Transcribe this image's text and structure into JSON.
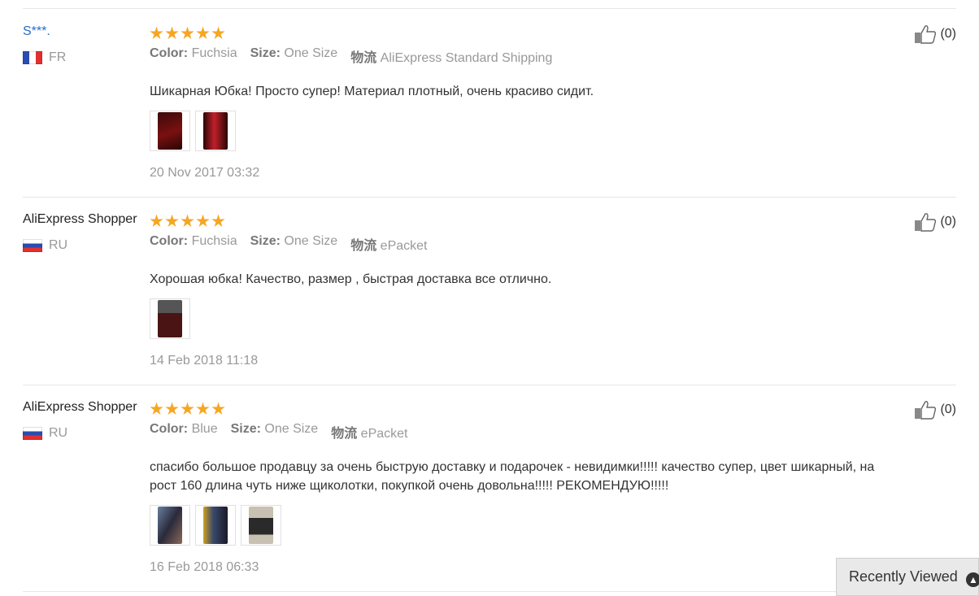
{
  "reviews": [
    {
      "user": "S***.",
      "country": "FR",
      "rating": 5,
      "color_label": "Color:",
      "color_value": "Fuchsia",
      "size_label": "Size:",
      "size_value": "One Size",
      "ship_label": "物流",
      "ship_value": "AliExpress Standard Shipping",
      "text": "Шикарная Юбка! Просто супер! Материал плотный, очень красиво сидит.",
      "date": "20 Nov 2017 03:32",
      "likes": "(0)",
      "photos": 2
    },
    {
      "user": "AliExpress Shopper",
      "country": "RU",
      "rating": 5,
      "color_label": "Color:",
      "color_value": "Fuchsia",
      "size_label": "Size:",
      "size_value": "One Size",
      "ship_label": "物流",
      "ship_value": "ePacket",
      "text": "Хорошая юбка! Качество, размер , быстрая доставка все отлично.",
      "date": "14 Feb 2018 11:18",
      "likes": "(0)",
      "photos": 1
    },
    {
      "user": "AliExpress Shopper",
      "country": "RU",
      "rating": 5,
      "color_label": "Color:",
      "color_value": "Blue",
      "size_label": "Size:",
      "size_value": "One Size",
      "ship_label": "物流",
      "ship_value": "ePacket",
      "text": "спасибо большое продавцу за очень быструю доставку и подарочек - невидимки!!!!! качество супер, цвет шикарный, на рост 160 длина чуть ниже щиколотки, покупкой очень довольна!!!!! РЕКОМЕНДУЮ!!!!!",
      "date": "16 Feb 2018 06:33",
      "likes": "(0)",
      "photos": 3
    }
  ],
  "recently_viewed": {
    "label": "Recently Viewed",
    "icon": "chevron-up-icon"
  },
  "colors": {
    "star": "#f6a623",
    "masked_user": "#2b6cc4",
    "meta_text": "#999999"
  }
}
